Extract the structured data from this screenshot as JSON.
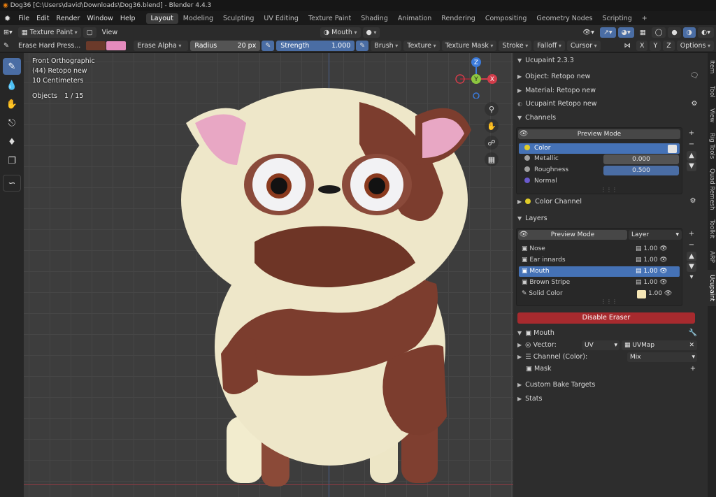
{
  "window": {
    "title": "Dog36 [C:\\Users\\david\\Downloads\\Dog36.blend] - Blender 4.4.3"
  },
  "menu": [
    "File",
    "Edit",
    "Render",
    "Window",
    "Help"
  ],
  "workspaces": [
    "Layout",
    "Modeling",
    "Sculpting",
    "UV Editing",
    "Texture Paint",
    "Shading",
    "Animation",
    "Rendering",
    "Compositing",
    "Geometry Nodes",
    "Scripting",
    "+"
  ],
  "header": {
    "mode": "Texture Paint",
    "view": "View",
    "material_slot": "Mouth",
    "brush_name": "Erase Hard Press...",
    "blend": "Erase Alpha",
    "radius_label": "Radius",
    "radius_value": "20 px",
    "strength_label": "Strength",
    "strength_value": "1.000",
    "brush": "Brush",
    "texture": "Texture",
    "texture_mask": "Texture Mask",
    "stroke": "Stroke",
    "falloff": "Falloff",
    "cursor": "Cursor",
    "axes": [
      "X",
      "Y",
      "Z"
    ],
    "options": "Options",
    "color_primary": "#6b3a2a",
    "color_secondary": "#e48bbd"
  },
  "viewport": {
    "view_name": "Front Orthographic",
    "object_name": "(44) Retopo new",
    "scale": "10 Centimeters",
    "objects_label": "Objects",
    "objects_value": "1 / 15",
    "gizmo": [
      "Z",
      "Y",
      "X"
    ]
  },
  "sidebar": {
    "addon_title": "Ucupaint 2.3.3",
    "object": "Object: Retopo new",
    "material": "Material: Retopo new",
    "node": "Ucupaint Retopo new",
    "channels_header": "Channels",
    "preview_mode": "Preview Mode",
    "channels": [
      {
        "name": "Color",
        "value": "",
        "color": "#e0cc28"
      },
      {
        "name": "Metallic",
        "value": "0.000",
        "color": "#a0a0a0"
      },
      {
        "name": "Roughness",
        "value": "0.500",
        "color": "#a0a0a0"
      },
      {
        "name": "Normal",
        "value": "",
        "color": "#6a5acd"
      }
    ],
    "color_channel": "Color Channel",
    "layers_header": "Layers",
    "layers_preview": "Preview Mode",
    "layers_type": "Layer",
    "layers": [
      {
        "name": "Nose",
        "opacity": "1.00"
      },
      {
        "name": "Ear innards",
        "opacity": "1.00"
      },
      {
        "name": "Mouth",
        "opacity": "1.00"
      },
      {
        "name": "Brown Stripe",
        "opacity": "1.00"
      },
      {
        "name": "Solid Color",
        "opacity": "1.00"
      }
    ],
    "disable_eraser": "Disable Eraser",
    "layer_detail": "Mouth",
    "vector_label": "Vector:",
    "vector_type": "UV",
    "uv_map": "UVMap",
    "channel_color_label": "Channel (Color):",
    "channel_color_blend": "Mix",
    "mask_label": "Mask",
    "custom_bake": "Custom Bake Targets",
    "stats": "Stats"
  },
  "tabs": [
    "Item",
    "Tool",
    "View",
    "Rig Tools",
    "Quad Remesh",
    "Toolkit",
    "ARP",
    "Ucupaint"
  ]
}
